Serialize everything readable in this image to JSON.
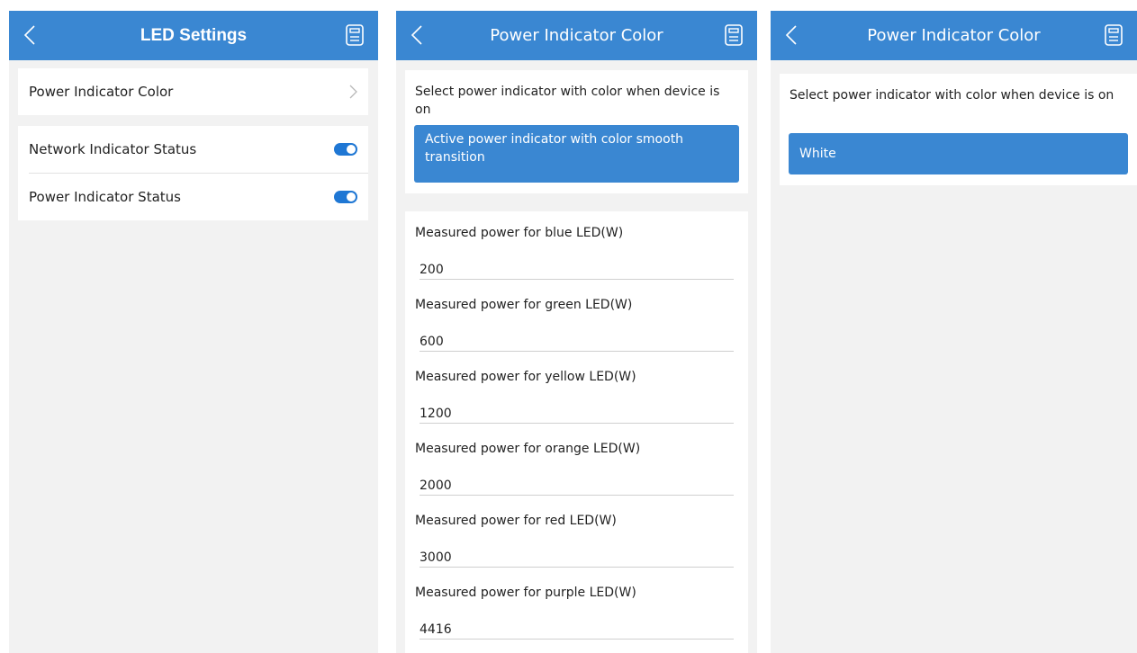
{
  "screens": [
    {
      "title": "LED Settings",
      "rows": [
        {
          "label": "Power Indicator Color",
          "control": "chevron-right-icon"
        },
        {
          "label": "Network Indicator Status",
          "control": "toggle",
          "on": true
        },
        {
          "label": "Power Indicator Status",
          "control": "toggle",
          "on": true
        }
      ]
    },
    {
      "title": "Power Indicator Color",
      "description": "Select power indicator with color when device is on",
      "selected_option": "Active power indicator with color smooth transition",
      "fields": [
        {
          "label": "Measured power for blue LED(W)",
          "value": "200"
        },
        {
          "label": "Measured power for green LED(W)",
          "value": "600"
        },
        {
          "label": "Measured power for yellow LED(W)",
          "value": "1200"
        },
        {
          "label": "Measured power for orange LED(W)",
          "value": "2000"
        },
        {
          "label": "Measured power for red LED(W)",
          "value": "3000"
        },
        {
          "label": "Measured power for purple LED(W)",
          "value": "4416"
        }
      ]
    },
    {
      "title": "Power Indicator Color",
      "description": "Select power indicator with color when device is on",
      "selected_option": "White"
    }
  ],
  "icons": {
    "back": "chevron-left-icon",
    "save": "save-icon"
  },
  "colors": {
    "accent": "#3a87d2",
    "toggle_on": "#1f77d4",
    "background": "#f2f2f2"
  }
}
